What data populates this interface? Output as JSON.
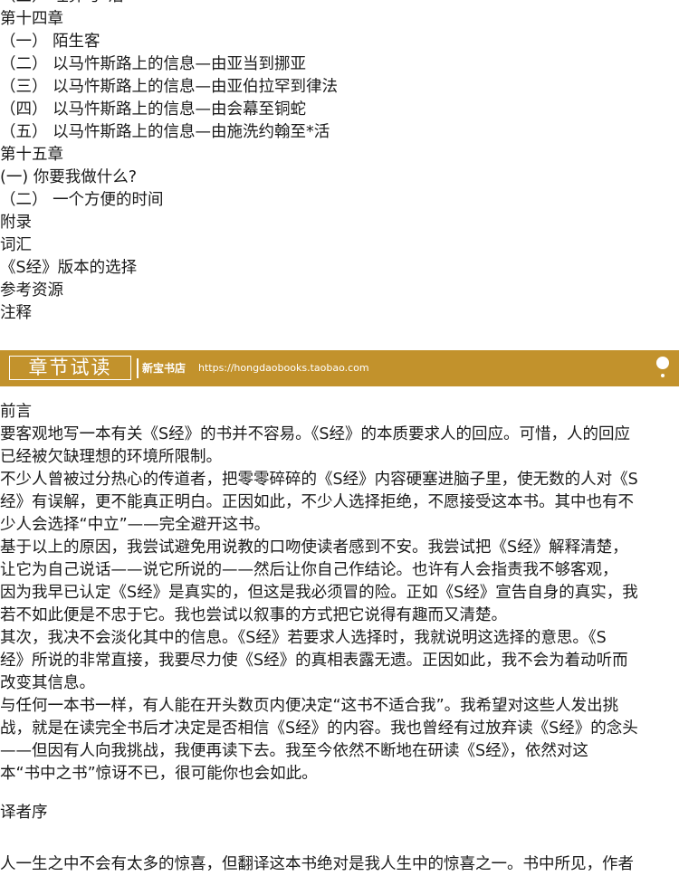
{
  "toc": {
    "lines": [
      "（三）  埋葬与*活",
      "第十四章",
      "（一）  陌生客",
      "（二）  以马忤斯路上的信息—由亚当到挪亚",
      "（三）  以马忤斯路上的信息—由亚伯拉罕到律法",
      "（四）  以马忤斯路上的信息—由会幕至铜蛇",
      "（五）  以马忤斯路上的信息—由施洗约翰至*活",
      "第十五章",
      "(一) 你要我做什么?",
      "（二）  一个方便的时间",
      "附录",
      "词汇",
      "《S经》版本的选择",
      "参考资源",
      "注释"
    ]
  },
  "banner": {
    "title": "章节试读",
    "store": "新宝书店",
    "url": "https://hongdaobooks.taobao.com",
    "background_color": "#c2922c"
  },
  "preface": {
    "heading": "前言",
    "lines": [
      "要客观地写一本有关《S经》的书并不容易。《S经》的本质要求人的回应。可惜，人的回应",
      "已经被欠缺理想的环境所限制。",
      "不少人曾被过分热心的传道者，把零零碎碎的《S经》内容硬塞进脑子里，使无数的人对《S",
      "经》有误解，更不能真正明白。正因如此，不少人选择拒绝，不愿接受这本书。其中也有不",
      "少人会选择“中立”——完全避开这书。",
      "基于以上的原因，我尝试避免用说教的口吻使读者感到不安。我尝试把《S经》解释清楚，",
      "让它为自己说话——说它所说的——然后让你自己作结论。也许有人会指责我不够客观，",
      "因为我早已认定《S经》是真实的，但这是我必须冒的险。正如《S经》宣告自身的真实，我",
      "若不如此便是不忠于它。我也尝试以叙事的方式把它说得有趣而又清楚。",
      "其次，我决不会淡化其中的信息。《S经》若要求人选择时，我就说明这选择的意思。《S",
      "经》所说的非常直接，我要尽力使《S经》的真相表露无遗。正因如此，我不会为着动听而",
      "改变其信息。",
      "与任何一本书一样，有人能在开头数页内便决定“这书不适合我”。我希望对这些人发出挑",
      "战，就是在读完全书后才决定是否相信《S经》的内容。我也曾经有过放弃读《S经》的念头",
      "——但因有人向我挑战，我便再读下去。我至今依然不断地在研读《S经》，依然对这",
      "本“书中之书”惊讶不已，很可能你也会如此。"
    ]
  },
  "translator": {
    "heading": "译者序",
    "first_line": "人一生之中不会有太多的惊喜，但翻译这本书绝对是我人生中的惊喜之一。书中所见，作者"
  }
}
